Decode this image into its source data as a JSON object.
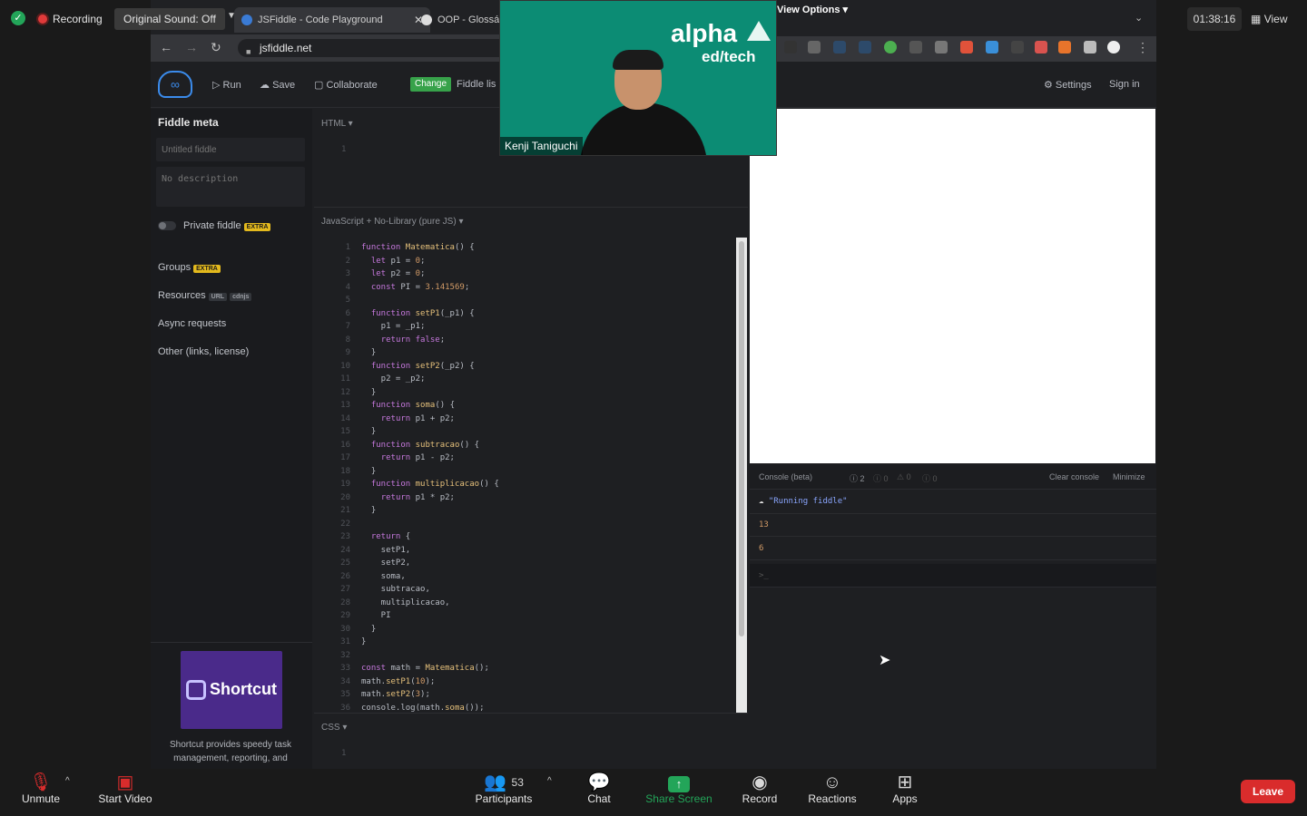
{
  "zoom": {
    "recording_label": "Recording",
    "original_sound": "Original Sound: Off",
    "timer": "01:38:16",
    "view_label": "View",
    "view_options_label": "View Options",
    "toolbar": {
      "unmute": "Unmute",
      "start_video": "Start Video",
      "participants": "Participants",
      "participants_count": "53",
      "chat": "Chat",
      "share_screen": "Share Screen",
      "record": "Record",
      "reactions": "Reactions",
      "apps": "Apps",
      "leave": "Leave"
    },
    "video_tile": {
      "name": "Kenji Taniguchi",
      "logo_line1": "alpha",
      "logo_line2": "ed/tech"
    }
  },
  "browser": {
    "tabs": [
      {
        "label": "JSFiddle - Code Playground",
        "active": true
      },
      {
        "label": "OOP - Glossá",
        "active": false
      }
    ],
    "url": "jsfiddle.net"
  },
  "jsfiddle": {
    "header": {
      "run": "Run",
      "save": "Save",
      "collaborate": "Collaborate",
      "change_badge": "Change",
      "fiddle_meta_link": "Fiddle lis",
      "settings": "Settings",
      "sign_in": "Sign in"
    },
    "sidebar": {
      "title": "Fiddle meta",
      "title_placeholder": "Untitled fiddle",
      "description_placeholder": "No description",
      "private_label": "Private fiddle",
      "extra_badge": "EXTRA",
      "groups": "Groups",
      "resources": "Resources",
      "url_badge": "URL",
      "cdnjs_badge": "cdnjs",
      "async": "Async requests",
      "other": "Other (links, license)",
      "ad_brand": "Shortcut",
      "ad_text": "Shortcut provides speedy task management, reporting, and"
    },
    "panels": {
      "html_label": "HTML ▾",
      "js_label": "JavaScript + No-Library (pure JS) ▾",
      "css_label": "CSS ▾"
    },
    "console": {
      "title": "Console (beta)",
      "counts": [
        "2",
        "0",
        "0",
        "0"
      ],
      "clear": "Clear console",
      "minimize": "Minimize",
      "running": "\"Running fiddle\"",
      "outputs": [
        "13",
        "6"
      ],
      "prompt": ">_"
    },
    "code_lines": [
      "function Matematica() {",
      "  let p1 = 0;",
      "  let p2 = 0;",
      "  const PI = 3.141569;",
      "",
      "  function setP1(_p1) {",
      "    p1 = _p1;",
      "    return false;",
      "  }",
      "  function setP2(_p2) {",
      "    p2 = _p2;",
      "  }",
      "  function soma() {",
      "    return p1 + p2;",
      "  }",
      "  function subtracao() {",
      "    return p1 - p2;",
      "  }",
      "  function multiplicacao() {",
      "    return p1 * p2;",
      "  }",
      "",
      "  return {",
      "    setP1,",
      "    setP2,",
      "    soma,",
      "    subtracao,",
      "    multiplicacao,",
      "    PI",
      "  }",
      "}",
      "",
      "const math = Matematica();",
      "math.setP1(10);",
      "math.setP2(3);",
      "console.log(math.soma());"
    ]
  },
  "colors": {
    "zoom_green": "#23a559",
    "leave_red": "#d92c2c",
    "video_bg": "#0c8c74",
    "extra_badge": "#e3b91d"
  }
}
